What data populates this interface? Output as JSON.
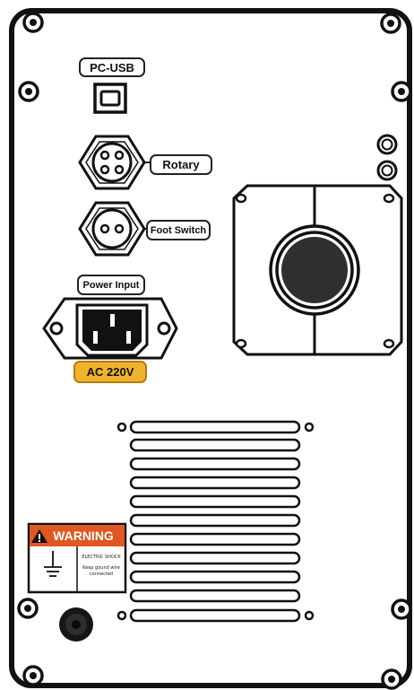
{
  "labels": {
    "pc_usb": "PC-USB",
    "rotary": "Rotary",
    "foot_switch": "Foot Switch",
    "power_input": "Power Input",
    "ac_voltage": "AC 220V"
  },
  "warning": {
    "title": "WARNING",
    "line1": "ELECTRIC SHOCK",
    "line2": "Keep gound wire",
    "line3": "connected"
  },
  "colors": {
    "panel_border": "#111111",
    "ac_badge": "#f0b32c",
    "warning_header": "#e0581f"
  }
}
